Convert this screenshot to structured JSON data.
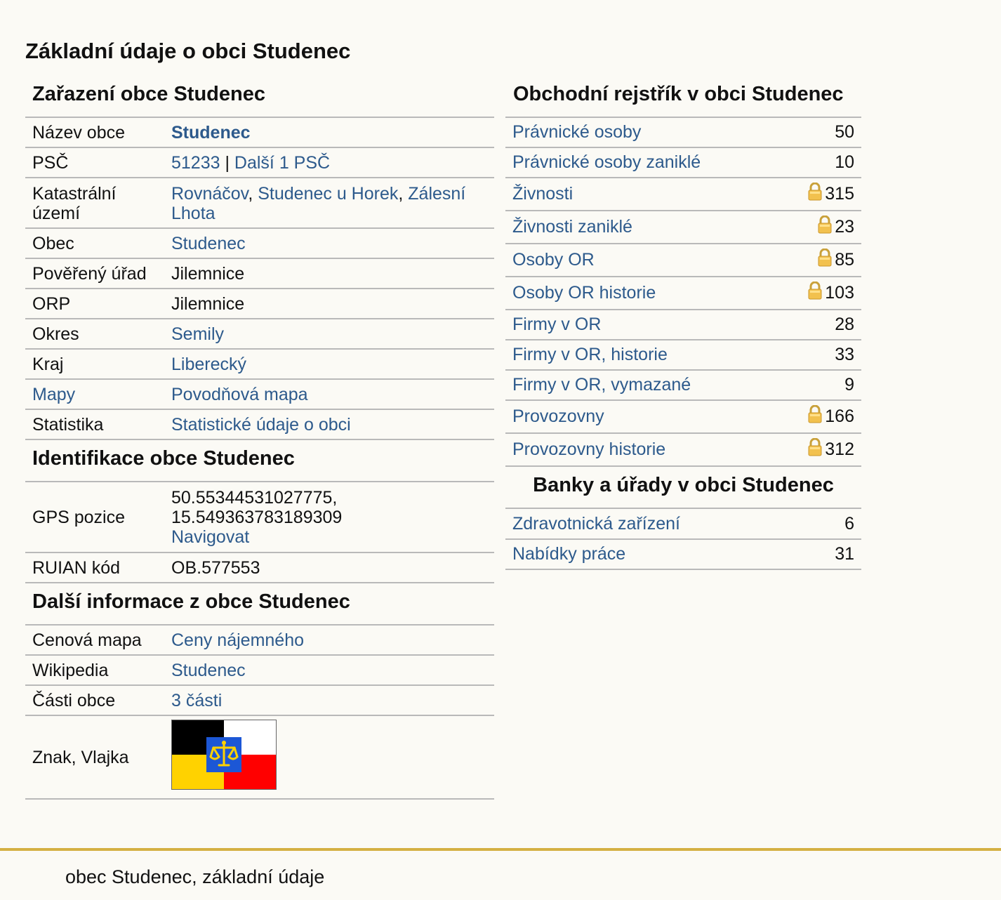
{
  "page_title": "Základní údaje o obci Studenec",
  "zarazeni": {
    "title": "Zařazení obce Studenec",
    "rows": {
      "nazev": {
        "label": "Název obce",
        "value": "Studenec"
      },
      "psc": {
        "label": "PSČ",
        "value": "51233",
        "separator": " | ",
        "more": "Další 1 PSČ"
      },
      "katastr": {
        "label": "Katastrální území",
        "items": [
          "Rovnáčov",
          "Studenec u Horek",
          "Zálesní Lhota"
        ],
        "separator": ", "
      },
      "obec": {
        "label": "Obec",
        "value": "Studenec"
      },
      "poverany": {
        "label": "Pověřený úřad",
        "value": "Jilemnice"
      },
      "orp": {
        "label": "ORP",
        "value": "Jilemnice"
      },
      "okres": {
        "label": "Okres",
        "value": "Semily"
      },
      "kraj": {
        "label": "Kraj",
        "value": "Liberecký"
      },
      "mapy": {
        "label": "Mapy",
        "value": "Povodňová mapa"
      },
      "statistika": {
        "label": "Statistika",
        "value": "Statistické údaje o obci"
      }
    }
  },
  "identifikace": {
    "title": "Identifikace obce Studenec",
    "gps": {
      "label": "GPS pozice",
      "lat": "50.55344531027775,",
      "lon": "15.549363783189309",
      "navigate": "Navigovat"
    },
    "ruian": {
      "label": "RUIAN kód",
      "value": "OB.577553"
    }
  },
  "dalsi": {
    "title": "Další informace z obce Studenec",
    "rows": {
      "cenova": {
        "label": "Cenová mapa",
        "value": "Ceny nájemného"
      },
      "wiki": {
        "label": "Wikipedia",
        "value": "Studenec"
      },
      "casti": {
        "label": "Části obce",
        "value": "3 části"
      },
      "znak": {
        "label": "Znak, Vlajka"
      }
    },
    "flag_colors": {
      "top_left": "#000000",
      "top_right": "#ffffff",
      "bottom_left": "#ffd200",
      "bottom_right": "#ff0000",
      "crest": "#1c57d6"
    }
  },
  "obchodni": {
    "title": "Obchodní rejstřík v obci Studenec",
    "rows": [
      {
        "label": "Právnické osoby",
        "value": "50",
        "locked": false
      },
      {
        "label": "Právnické osoby zaniklé",
        "value": "10",
        "locked": false
      },
      {
        "label": "Živnosti",
        "value": "315",
        "locked": true
      },
      {
        "label": "Živnosti zaniklé",
        "value": "23",
        "locked": true
      },
      {
        "label": "Osoby OR",
        "value": "85",
        "locked": true
      },
      {
        "label": "Osoby OR historie",
        "value": "103",
        "locked": true
      },
      {
        "label": "Firmy v OR",
        "value": "28",
        "locked": false
      },
      {
        "label": "Firmy v OR, historie",
        "value": "33",
        "locked": false
      },
      {
        "label": "Firmy v OR, vymazané",
        "value": "9",
        "locked": false
      },
      {
        "label": "Provozovny",
        "value": "166",
        "locked": true
      },
      {
        "label": "Provozovny historie",
        "value": "312",
        "locked": true
      }
    ]
  },
  "banky": {
    "title": "Banky a úřady v obci Studenec",
    "rows": [
      {
        "label": "Zdravotnická zařízení",
        "value": "6"
      },
      {
        "label": "Nabídky práce",
        "value": "31"
      }
    ]
  },
  "footer": {
    "text": "obec Studenec, základní údaje"
  },
  "icons": {
    "lock": "lock-icon"
  },
  "colors": {
    "link": "#2d5a8c",
    "footer_line": "#d4b043",
    "background": "#fbfaf5"
  }
}
